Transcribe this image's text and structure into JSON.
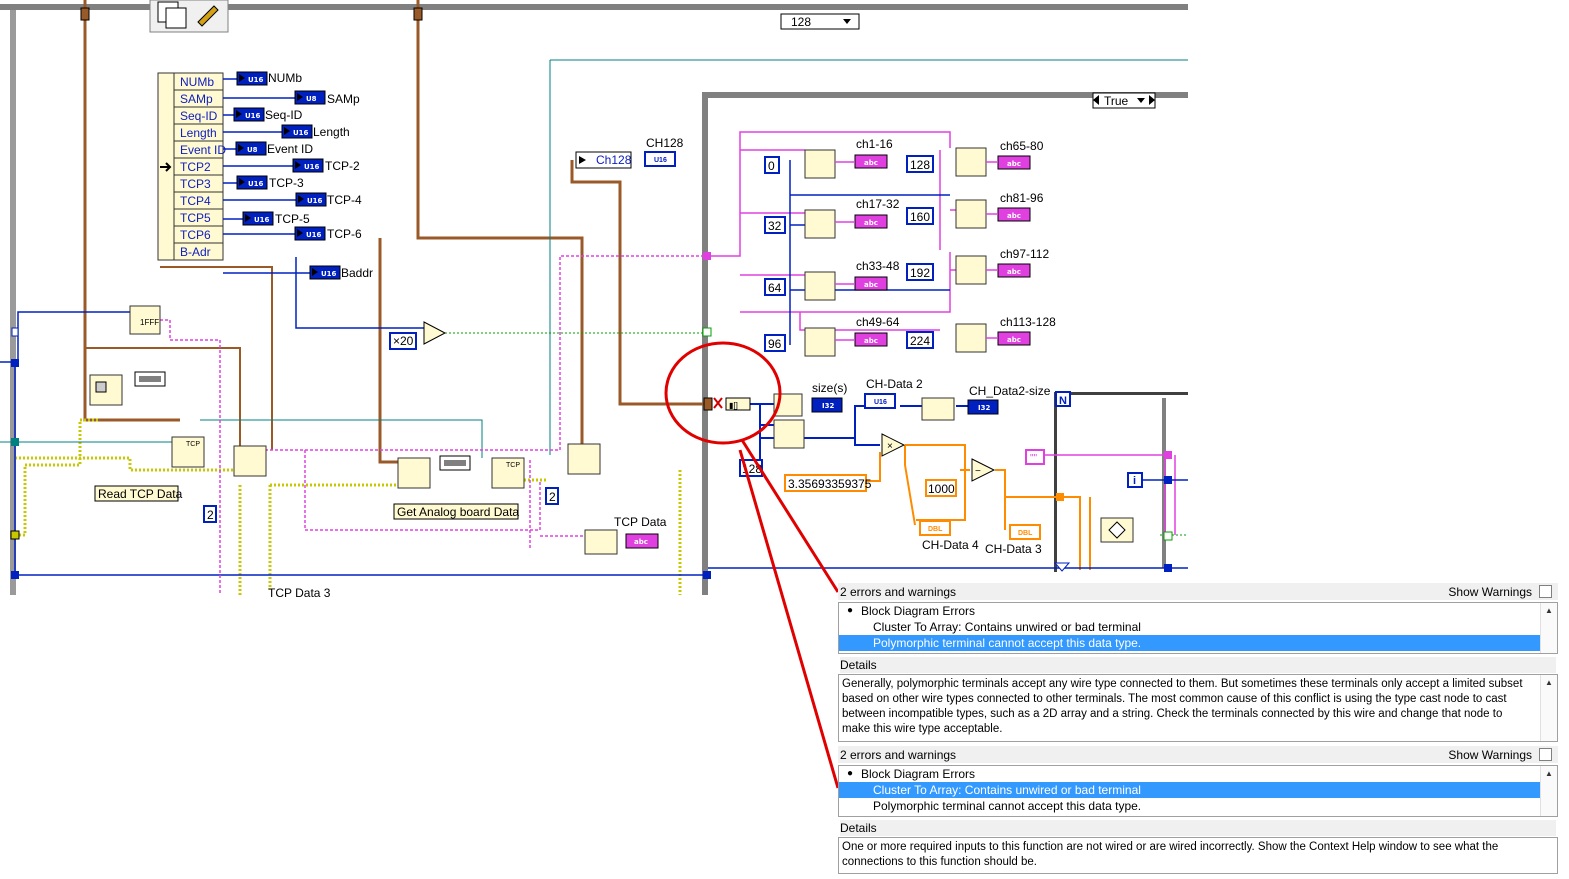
{
  "diagram": {
    "selector_case": "True",
    "selector_count": "128",
    "cluster_elements": [
      "NUMb",
      "SAMp",
      "Seq-ID",
      "Length",
      "Event ID",
      "TCP2",
      "TCP3",
      "TCP4",
      "TCP5",
      "TCP6",
      "B-Adr"
    ],
    "indicators": [
      {
        "tag": "U16",
        "name": "NUMb"
      },
      {
        "tag": "U8",
        "name": "SAMp"
      },
      {
        "tag": "U16",
        "name": "Seq-ID"
      },
      {
        "tag": "U16",
        "name": "Length"
      },
      {
        "tag": "U8",
        "name": "Event ID"
      },
      {
        "tag": "U16",
        "name": "TCP-2"
      },
      {
        "tag": "U16",
        "name": "TCP-3"
      },
      {
        "tag": "U16",
        "name": "TCP-4"
      },
      {
        "tag": "U16",
        "name": "TCP-5"
      },
      {
        "tag": "U16",
        "name": "TCP-6"
      },
      {
        "tag": "U16",
        "name": "Baddr"
      }
    ],
    "ch128_const": "Ch128",
    "ch128_label": "CH128",
    "ch128_tag": "U16",
    "channel_offsets": [
      "0",
      "32",
      "64",
      "96"
    ],
    "channel_offsets_right": [
      "128",
      "160",
      "192",
      "224"
    ],
    "channel_labels_left": [
      "ch1-16",
      "ch17-32",
      "ch33-48",
      "ch49-64"
    ],
    "channel_labels_right": [
      "ch65-80",
      "ch81-96",
      "ch97-112",
      "ch113-128"
    ],
    "abc_tag": "abc",
    "x20_const": "×20",
    "size_label": "size(s)",
    "size_tag": "I32",
    "chdata2_label": "CH-Data 2",
    "chdata2_tag": "U16",
    "chdata2size_label": "CH_Data2-size",
    "chdata2size_tag": "I32",
    "multiplier_const": "3.35693359375",
    "const_1000": "1000",
    "const_128": "128",
    "const_2a": "2",
    "const_2b": "2",
    "chdata4_label": "CH-Data 4",
    "chdata3_label": "CH-Data 3",
    "dbl_tag": "DBL",
    "read_tcp_label": "Read TCP Data",
    "get_analog_label": "Get Analog board Data",
    "tcp_data_label": "TCP Data",
    "tcp_data3_label": "TCP Data 3",
    "tcp_tag": "TCP",
    "for_n": "N",
    "for_i": "i",
    "string_const": "\"\"",
    "hex_tag": "1FFF"
  },
  "error_panel_1": {
    "title": "2 errors and warnings",
    "show_warnings": "Show Warnings",
    "group": "Block Diagram Errors",
    "item_1": "Cluster To Array: Contains unwired or bad terminal",
    "item_2": "Polymorphic terminal cannot accept this data type.",
    "details_label": "Details",
    "details_text": "Generally, polymorphic terminals accept any wire type connected to them. But sometimes these terminals only accept a limited subset based on other wire types connected to other terminals. The most common cause of this conflict is using the type cast node to cast between incompatible types, such as a 2D array and a string. Check the terminals connected by this wire and change that node to make this wire type acceptable."
  },
  "error_panel_2": {
    "title": "2 errors and warnings",
    "show_warnings": "Show Warnings",
    "group": "Block Diagram Errors",
    "item_1": "Cluster To Array: Contains unwired or bad terminal",
    "item_2": "Polymorphic terminal cannot accept this data type.",
    "details_label": "Details",
    "details_text": "One or more required inputs to this function are not wired or are wired incorrectly. Show the Context Help window to see what the connections to this function should be."
  },
  "colors": {
    "wire_cluster": "#9a5a28",
    "wire_string": "#e040e0",
    "wire_int": "#0020c0",
    "wire_error": "#c8c800",
    "wire_dbl": "#ff8c00",
    "annotation": "#e00000",
    "selection": "#3399ff"
  }
}
